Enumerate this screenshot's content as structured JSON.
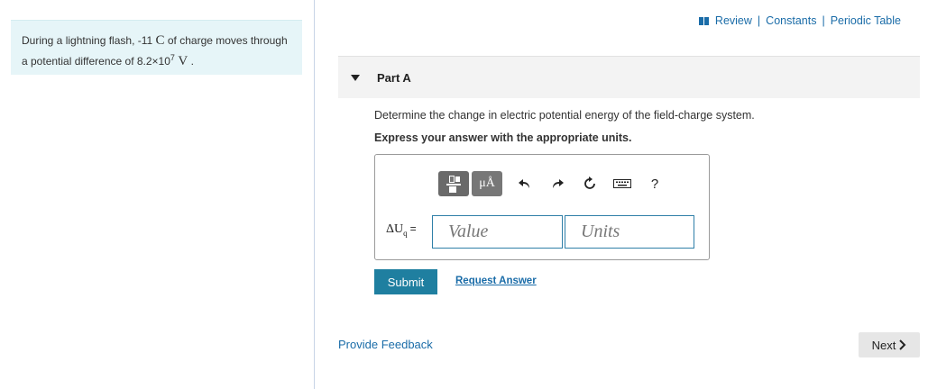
{
  "problem": {
    "text_before": "During a lightning flash, -11 ",
    "unit_c": "C",
    "text_middle": " of charge moves through a potential difference of 8.2×10",
    "exponent": "7",
    "unit_v": " V",
    "text_end": " ."
  },
  "top_links": {
    "review": "Review",
    "sep1": "|",
    "constants": "Constants",
    "sep2": "|",
    "periodic_table": "Periodic Table"
  },
  "part": {
    "title": "Part A",
    "question": "Determine the change in electric potential energy of the field-charge system.",
    "instruction": "Express your answer with the appropriate units."
  },
  "toolbar": {
    "units_button": "μÅ",
    "help": "?"
  },
  "answer": {
    "label_main": "ΔU",
    "label_sub": "q",
    "label_eq": "=",
    "value_placeholder": "Value",
    "units_placeholder": "Units"
  },
  "actions": {
    "submit": "Submit",
    "request_answer": "Request Answer",
    "provide_feedback": "Provide Feedback",
    "next": "Next"
  },
  "icons": [
    "bar-chart-icon",
    "caret-down-icon",
    "templates-icon",
    "undo-icon",
    "redo-icon",
    "reset-icon",
    "keyboard-icon",
    "help-icon",
    "chevron-right-icon"
  ]
}
